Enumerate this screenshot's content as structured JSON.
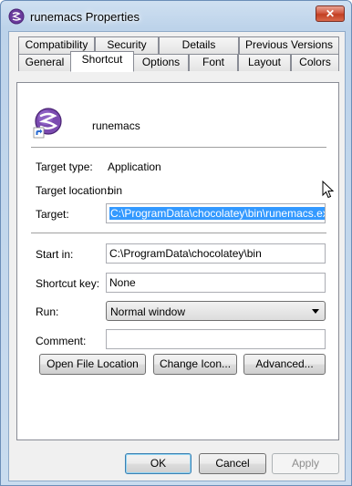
{
  "window": {
    "title": "runemacs Properties",
    "close_glyph": "✕"
  },
  "tabs_row1": [
    {
      "label": "Compatibility"
    },
    {
      "label": "Security"
    },
    {
      "label": "Details"
    },
    {
      "label": "Previous Versions"
    }
  ],
  "tabs_row2": [
    {
      "label": "General"
    },
    {
      "label": "Shortcut"
    },
    {
      "label": "Options"
    },
    {
      "label": "Font"
    },
    {
      "label": "Layout"
    },
    {
      "label": "Colors"
    }
  ],
  "active_tab": "Shortcut",
  "app": {
    "name": "runemacs",
    "icon": "emacs-icon"
  },
  "fields": {
    "target_type_label": "Target type:",
    "target_type_value": "Application",
    "target_location_label": "Target location:",
    "target_location_value": "bin",
    "target_label": "Target:",
    "target_value": "C:\\ProgramData\\chocolatey\\bin\\runemacs.exe",
    "start_in_label": "Start in:",
    "start_in_value": "C:\\ProgramData\\chocolatey\\bin",
    "shortcut_key_label": "Shortcut key:",
    "shortcut_key_value": "None",
    "run_label": "Run:",
    "run_value": "Normal window",
    "comment_label": "Comment:",
    "comment_value": ""
  },
  "panel_buttons": {
    "open_file_location": "Open File Location",
    "change_icon": "Change Icon...",
    "advanced": "Advanced..."
  },
  "dialog_buttons": {
    "ok": "OK",
    "cancel": "Cancel",
    "apply": "Apply"
  },
  "colors": {
    "selection": "#3399ff",
    "close_button": "#c23f22"
  }
}
